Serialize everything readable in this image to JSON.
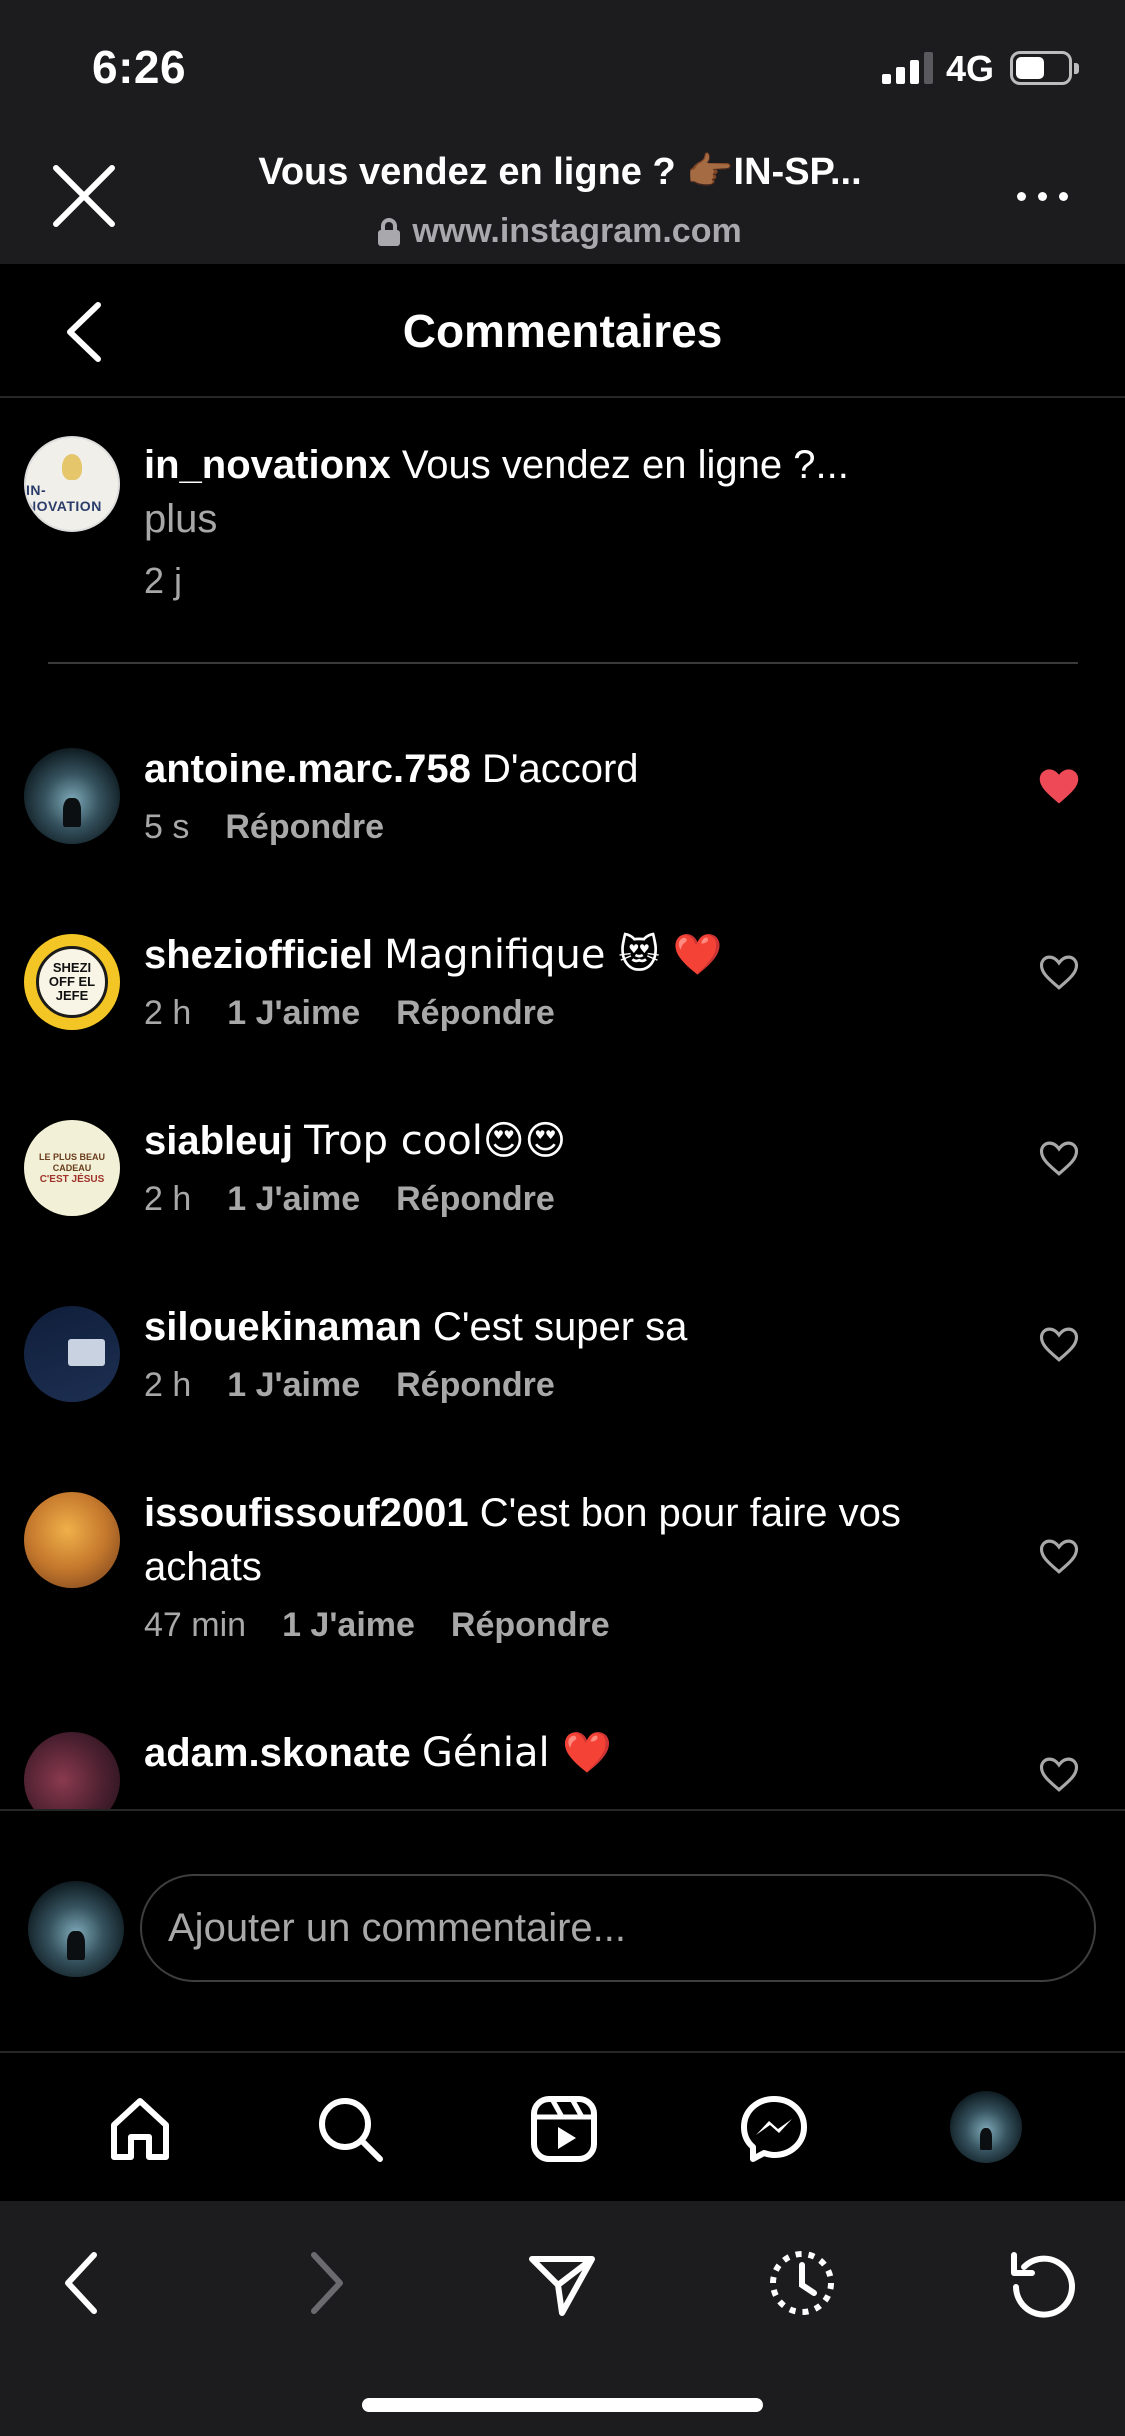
{
  "status_bar": {
    "time": "6:26",
    "network": "4G",
    "signal_bars": 3,
    "signal_max": 4,
    "battery_level": 0.55
  },
  "browser": {
    "title": "Vous vendez en ligne ? 👉🏾IN-SP...",
    "url": "www.instagram.com"
  },
  "header": {
    "title": "Commentaires"
  },
  "caption": {
    "username": "in_novationx",
    "text": "Vous vendez en ligne ?...",
    "more": "plus",
    "time": "2 j",
    "avatar_text": "IN-NOVATION"
  },
  "comments": [
    {
      "username": "antoine.marc.758",
      "text": "D'accord",
      "time": "5 s",
      "likes": "",
      "reply": "Répondre",
      "liked": true
    },
    {
      "username": "sheziofficiel",
      "text": "Magnifique 😻 ❤️",
      "time": "2 h",
      "likes": "1 J'aime",
      "reply": "Répondre",
      "liked": false,
      "avatar_text": "SHEZI OFF EL JEFE"
    },
    {
      "username": "siableuj",
      "text": "Trop cool😍😍",
      "time": "2 h",
      "likes": "1 J'aime",
      "reply": "Répondre",
      "liked": false,
      "avatar_text": "LE PLUS BEAU CADEAU",
      "avatar_sub": "C'EST JÉSUS"
    },
    {
      "username": "silouekinaman",
      "text": "C'est super sa",
      "time": "2 h",
      "likes": "1 J'aime",
      "reply": "Répondre",
      "liked": false
    },
    {
      "username": "issoufissouf2001",
      "text": "C'est bon pour faire vos achats",
      "time": "47 min",
      "likes": "1 J'aime",
      "reply": "Répondre",
      "liked": false
    },
    {
      "username": "adam.skonate",
      "text": "Génial ❤️",
      "time": "",
      "likes": "",
      "reply": "",
      "liked": false
    }
  ],
  "add_comment": {
    "placeholder": "Ajouter un commentaire..."
  },
  "nav": {
    "tabs": [
      "home-icon",
      "search-icon",
      "reels-icon",
      "messenger-icon",
      "profile-avatar"
    ]
  },
  "safari_toolbar": {
    "buttons": [
      "back-arrow-icon",
      "forward-arrow-icon",
      "share-icon",
      "history-icon",
      "reload-icon"
    ]
  },
  "colors": {
    "background": "#000000",
    "chrome": "#1c1c1e",
    "like_red": "#ed4956",
    "muted_text": "#a8a8a8"
  }
}
